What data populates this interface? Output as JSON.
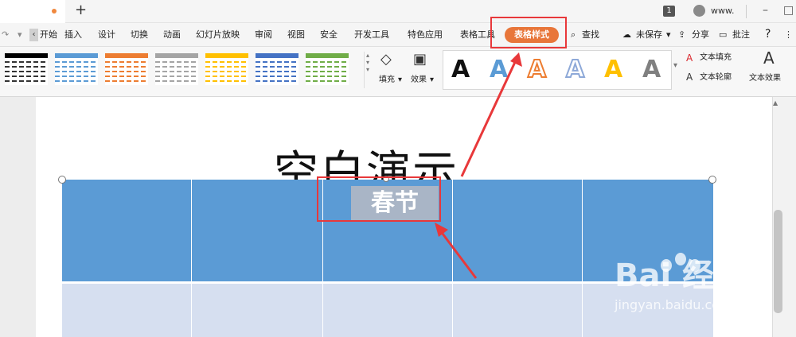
{
  "titlebar": {
    "new_tab": "+",
    "page_badge": "1",
    "user_name": "www.",
    "minimize": "–",
    "restore": "□"
  },
  "menu": {
    "items": [
      "开始",
      "插入",
      "设计",
      "切换",
      "动画",
      "幻灯片放映",
      "审阅",
      "视图",
      "安全",
      "开发工具",
      "特色应用",
      "表格工具"
    ],
    "active_tab": "表格样式",
    "search": "查找",
    "save_status": "未保存",
    "share": "分享",
    "comment": "批注",
    "help": "?"
  },
  "toolbar": {
    "fill_label": "填充",
    "effect_label": "效果",
    "text_fill_label": "文本填充",
    "text_outline_label": "文本轮廓",
    "text_effect_label": "文本效果",
    "wordart_letter": "A",
    "table_style_colors": [
      "#000000",
      "#5b9bd5",
      "#ed7d31",
      "#a5a5a5",
      "#ffc000",
      "#4472c4",
      "#70ad47"
    ],
    "wordart_colors": [
      "#111111",
      "#5b9bd5",
      "#ed7d31",
      "#8ea9d8",
      "#ffc000",
      "#808080"
    ]
  },
  "slide": {
    "title": "空白演示",
    "cell_text": "春节"
  },
  "watermark": {
    "brand": "Bai 经验",
    "sub": "jingyan.baidu.com"
  },
  "colors": {
    "accent_orange": "#e8763a",
    "highlight_red": "#e8383a",
    "table_header_blue": "#5b9bd5",
    "table_body_blue": "#d6dff0"
  }
}
